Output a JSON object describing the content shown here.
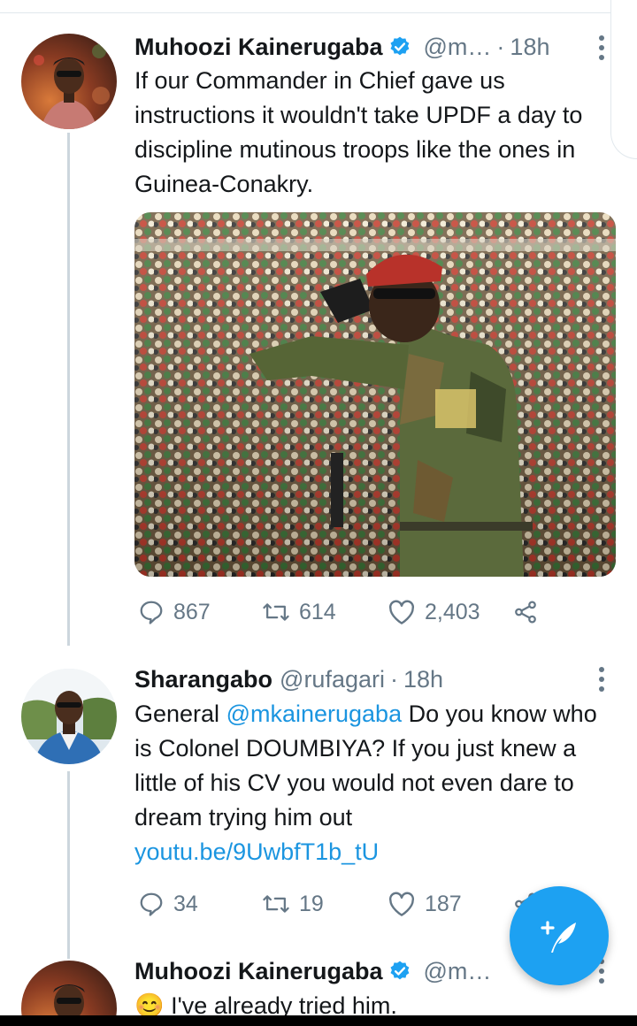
{
  "tweets": [
    {
      "name": "Muhoozi Kainerugaba",
      "handle": "@m…",
      "dot": "·",
      "time": "18h",
      "text": "If our Commander in Chief gave us instructions it wouldn't take UPDF a day to discipline mutinous troops like the ones in Guinea-Conakry.",
      "replies": "867",
      "retweets": "614",
      "likes": "2,403"
    },
    {
      "name": "Sharangabo",
      "handle": "@rufagari",
      "dot": "·",
      "time": "18h",
      "text_prefix": "General ",
      "mention": "@mkainerugaba",
      "text_rest": " Do you know who is Colonel DOUMBIYA? If you just knew a little of his CV you would not even dare to dream trying him out",
      "link": "youtu.be/9UwbfT1b_tU",
      "replies": "34",
      "retweets": "19",
      "likes": "187"
    },
    {
      "name": "Muhoozi Kainerugaba",
      "handle": "@m…",
      "emoji": "😊",
      "text": "I've already tried him."
    }
  ],
  "colors": {
    "accent": "#1da1f2",
    "link": "#1b95e0",
    "secondary_text": "#657786",
    "thread_line": "#ccd6dd"
  },
  "icons": [
    "verified-icon",
    "reply-icon",
    "retweet-icon",
    "like-icon",
    "share-icon",
    "more-icon",
    "compose-tweet-icon"
  ]
}
